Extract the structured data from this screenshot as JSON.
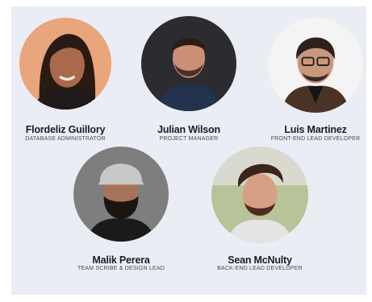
{
  "team": {
    "members": [
      {
        "name": "Flordeliz Guillory",
        "role": "DATABASE ADMINISTRATOR",
        "photo_bg": "#e9a57c"
      },
      {
        "name": "Julian Wilson",
        "role": "PROJECT MANAGER",
        "photo_bg": "#2b2b30"
      },
      {
        "name": "Luis Martinez",
        "role": "FRONT-END LEAD DEVELOPER",
        "photo_bg": "#f4f4f4"
      },
      {
        "name": "Malik Perera",
        "role": "TEAM SCRIBE & DESIGN LEAD",
        "photo_bg": "#7e7e7e"
      },
      {
        "name": "Sean McNulty",
        "role": "BACK-END LEAD DEVELOPER",
        "photo_bg": "#b7c49a"
      }
    ]
  }
}
